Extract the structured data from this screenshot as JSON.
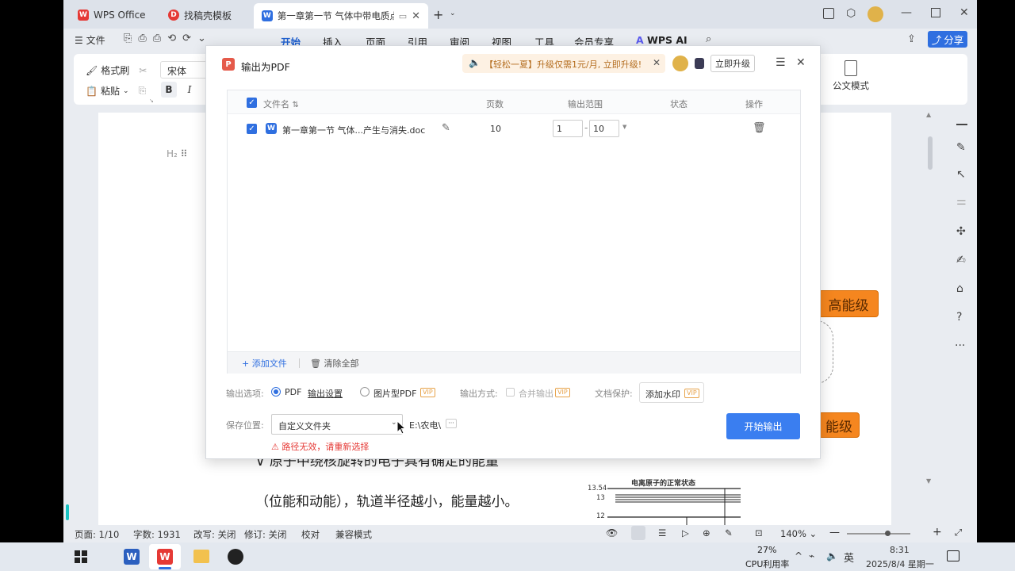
{
  "tabs": {
    "wps_home": "WPS Office",
    "template": "找稿壳模板",
    "document": "第一章第一节 气体中带电质点"
  },
  "menubar": {
    "file": "文件",
    "items": [
      "开始",
      "插入",
      "页面",
      "引用",
      "审阅",
      "视图",
      "工具",
      "会员专享"
    ],
    "wps_ai": "WPS AI",
    "share": "分享"
  },
  "ribbon": {
    "format_painter": "格式刷",
    "paste": "粘贴",
    "font_name": "宋体",
    "bold": "B",
    "italic": "I",
    "official_mode": "公文模式"
  },
  "document": {
    "heading_marker": "H₂",
    "line_partial": "原子中绕核旋转的电子具有确定的能量",
    "line2": "（位能和动能），轨道半径越小，能量越小。",
    "box_high": "高能级",
    "box_low": "能级",
    "figure_title": "电离原子的正常状态",
    "figure_tick_top": "13.54",
    "figure_tick_13": "13",
    "figure_tick_12": "12"
  },
  "dialog": {
    "title": "输出为PDF",
    "promo_text": "【轻松一夏】升级仅需1元/月, 立即升级!",
    "upgrade_button": "立即升级",
    "columns": {
      "filename": "文件名",
      "pages": "页数",
      "range": "输出范围",
      "status": "状态",
      "action": "操作"
    },
    "row": {
      "filename": "第一章第一节 气体...产生与消失.doc",
      "pages": "10",
      "range_from": "1",
      "range_to": "10"
    },
    "add_file": "添加文件",
    "clear_all": "清除全部",
    "output_options_label": "输出选项:",
    "opt_pdf": "PDF",
    "output_settings": "输出设置",
    "opt_image_pdf": "图片型PDF",
    "output_mode_label": "输出方式:",
    "merge_output": "合并输出",
    "doc_protect_label": "文档保护:",
    "add_watermark": "添加水印",
    "vip": "VIP",
    "save_location_label": "保存位置:",
    "save_location_value": "自定义文件夹",
    "path": "E:\\农电\\",
    "more": "···",
    "error_text": "路径无效，请重新选择",
    "start_button": "开始输出"
  },
  "statusbar": {
    "page": "页面: 1/10",
    "words": "字数: 1931",
    "spell": "改写: 关闭",
    "revision": "修订: 关闭",
    "proofread": "校对",
    "compat": "兼容模式",
    "zoom": "140%"
  },
  "taskbar": {
    "cpu_percent": "27%",
    "cpu_label": "CPU利用率",
    "ime": "英",
    "time": "8:31",
    "date": "2025/8/4 星期一"
  },
  "colors": {
    "accent": "#2f6fe0",
    "start_button": "#3a7ef0",
    "error": "#e53935",
    "orange_box": "#f5861f",
    "wps_red": "#e53935"
  }
}
